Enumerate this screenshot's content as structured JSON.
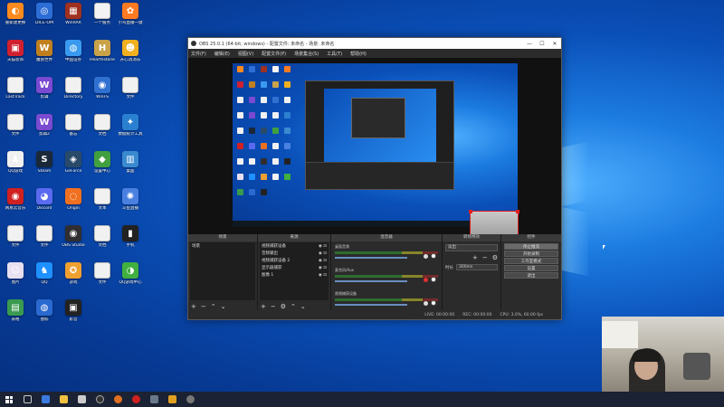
{
  "desktop": {
    "icons": [
      {
        "label": "重新建更换",
        "color": "#ff8a1d",
        "glyph": "◐"
      },
      {
        "label": "DICE-OM",
        "color": "#2d6dd6",
        "glyph": "◎"
      },
      {
        "label": "WinRAR",
        "color": "#a03020",
        "glyph": "▦"
      },
      {
        "label": "一个服务",
        "color": "#f3f3f3",
        "glyph": " "
      },
      {
        "label": "小鸟直播一键",
        "color": "#ff7a20",
        "glyph": "✿"
      },
      {
        "label": "天猫装饰",
        "color": "#d02030",
        "glyph": "▣"
      },
      {
        "label": "魔兽世界",
        "color": "#c08020",
        "glyph": "W"
      },
      {
        "label": "中国证券",
        "color": "#3a9af0",
        "glyph": "◍"
      },
      {
        "label": "Hearthstone",
        "color": "#c9a24a",
        "glyph": "H"
      },
      {
        "label": "开心消消乐",
        "color": "#f0b020",
        "glyph": "☻"
      },
      {
        "label": "LastTrack",
        "color": "#f1f1f1",
        "glyph": " "
      },
      {
        "label": "剪辑",
        "color": "#7a4ad0",
        "glyph": "W"
      },
      {
        "label": "Directory",
        "color": "#f1f1f1",
        "glyph": " "
      },
      {
        "label": "WinFS",
        "color": "#3070d0",
        "glyph": "◉"
      },
      {
        "label": "文件",
        "color": "#f1f1f1",
        "glyph": " "
      },
      {
        "label": "文件",
        "color": "#f1f1f1",
        "glyph": " "
      },
      {
        "label": "剪辑2",
        "color": "#7a4ad0",
        "glyph": "W"
      },
      {
        "label": "备忘",
        "color": "#f1f1f1",
        "glyph": " "
      },
      {
        "label": "文档",
        "color": "#f1f1f1",
        "glyph": " "
      },
      {
        "label": "数据统计工具",
        "color": "#2a80d0",
        "glyph": "✦"
      },
      {
        "label": "QQ游戏",
        "color": "#f0f0f0",
        "glyph": "♟"
      },
      {
        "label": "Steam",
        "color": "#1b2838",
        "glyph": "S"
      },
      {
        "label": "GeForce",
        "color": "#2a4a6a",
        "glyph": "◈"
      },
      {
        "label": "设置中心",
        "color": "#40a040",
        "glyph": "◆"
      },
      {
        "label": "桌面",
        "color": "#3a8ad0",
        "glyph": "▥"
      },
      {
        "label": "网易云音乐",
        "color": "#d02020",
        "glyph": "◉"
      },
      {
        "label": "Discord",
        "color": "#5a6af0",
        "glyph": "◕"
      },
      {
        "label": "Origin",
        "color": "#f07020",
        "glyph": "◌"
      },
      {
        "label": "文本",
        "color": "#f1f1f1",
        "glyph": " "
      },
      {
        "label": "斗鱼直播",
        "color": "#4a80e0",
        "glyph": "✺"
      },
      {
        "label": "文件",
        "color": "#f1f1f1",
        "glyph": " "
      },
      {
        "label": "文件",
        "color": "#f1f1f1",
        "glyph": " "
      },
      {
        "label": "OBS Studio",
        "color": "#302e31",
        "glyph": "◉"
      },
      {
        "label": "文档",
        "color": "#f1f1f1",
        "glyph": " "
      },
      {
        "label": "手机",
        "color": "#222222",
        "glyph": "▮"
      },
      {
        "label": "图片",
        "color": "#e8e0f0",
        "glyph": "☺"
      },
      {
        "label": "QQ",
        "color": "#1e90ff",
        "glyph": "♞"
      },
      {
        "label": "游戏",
        "color": "#f0a030",
        "glyph": "✪"
      },
      {
        "label": "文件",
        "color": "#f1f1f1",
        "glyph": " "
      },
      {
        "label": "QQ游戏中心",
        "color": "#40b040",
        "glyph": "◑"
      },
      {
        "label": "表格",
        "color": "#3a9a50",
        "glyph": "▤"
      },
      {
        "label": "图标",
        "color": "#2a6ad0",
        "glyph": "◍"
      },
      {
        "label": "影音",
        "color": "#222222",
        "glyph": "▣"
      }
    ]
  },
  "obs": {
    "title": "OBS 25.0.1 (64-bit, windows) - 配置文件: 未命名 - 场景: 未命名",
    "menu": [
      "文件(F)",
      "编辑(E)",
      "视图(V)",
      "配置文件(P)",
      "场景集合(S)",
      "工具(T)",
      "帮助(H)"
    ],
    "docks": {
      "scenes": {
        "title": "场景",
        "items": [
          "场景"
        ]
      },
      "sources": {
        "title": "来源",
        "items": [
          "视频捕获设备",
          "音频输出",
          "视频捕获设备 2",
          "显示器捕获",
          "图像 1"
        ]
      },
      "mixer": {
        "title": "混音器",
        "channels": [
          {
            "name": "桌面音频",
            "level": "0.0 dB"
          },
          {
            "name": "麦克风/Aux",
            "level": "0.0 dB"
          },
          {
            "name": "视频捕获设备",
            "level": "0.0 dB"
          }
        ]
      },
      "transitions": {
        "title": "转场特效",
        "type": "淡出",
        "duration_label": "时长",
        "duration": "300ms"
      },
      "controls": {
        "title": "控件",
        "buttons": [
          "停止推流",
          "开始录制",
          "工作室模式",
          "设置",
          "退出"
        ]
      }
    },
    "status": {
      "live": "LIVE: 00:00:00",
      "rec": "REC: 00:00:00",
      "cpu": "CPU: 3.0%, 60.00 fps"
    }
  },
  "taskbar": {
    "icons": [
      "task-view",
      "browser",
      "folder",
      "store",
      "obs",
      "media",
      "netease",
      "steam",
      "game",
      "clock"
    ]
  }
}
